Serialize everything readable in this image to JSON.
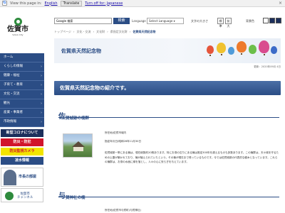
{
  "translate_bar": {
    "view_label": "View this page in:",
    "language_link": "English",
    "translate_button": "Translate",
    "turn_off_label": "Turn off for: Japanese",
    "close_glyph": "×"
  },
  "header": {
    "logo_name": "佐賀市",
    "logo_sub": "SAGA City",
    "search_value": "Google 検索",
    "search_button": "検索",
    "language_label": "Language",
    "language_select": "Select Language ▾",
    "font_size_label": "文字の大きさ",
    "font_size_buttons": [
      "標準",
      "拡大"
    ],
    "color_label": "背景色",
    "background_colors": [
      "#ffffff",
      "#1c2f5c",
      "#1c2f5c"
    ]
  },
  "breadcrumb": [
    "トップページ",
    "›",
    "文化・交流",
    "›",
    "文化財",
    "›",
    "県指定文化財",
    "›"
  ],
  "breadcrumb_current": "佐賀県天然記念物",
  "sidebar": {
    "items": [
      "ホーム",
      "くらしの情報",
      "健康・福祉",
      "子育て・教育",
      "文化・交流",
      "観光",
      "産業・事業者",
      "市政情報"
    ],
    "banners": [
      "新型コロナについて",
      "防災・防犯",
      "防災監視カメラ",
      "凌水情報"
    ],
    "mayor_label": "市長の部屋",
    "channel_label_1": "佐賀市",
    "channel_label_2": "チャンネル"
  },
  "hero": {
    "title": "佐賀県天然記念物"
  },
  "update_text": "更新：2020年09月 4日",
  "intro_heading": "佐賀県天然記念物の紹介です。",
  "sections": [
    {
      "initial": "佐",
      "title_rest": "賀城跡の楠群",
      "location": "所在地(佐賀市城内",
      "designated": "指定年月日(昭和28年11月30日",
      "description": "佐賀城跡一帯にある楠は、現在総数約20株あります。特にお濠の辺りにある楠は推定300年を超えるものも多数あります。この楠群は、天々城を守るための土塁が築かれており、楠が植えられていたという。その楠が現在まで残っているものです。今では佐賀城跡の代表的な樹木となっています。これらの楠群は、お濠の水面に緑を落とし、人々の心に安らぎを与えています。"
    },
    {
      "initial": "与",
      "title_rest": "賀神社の楠",
      "location": "所在地(佐賀市与賀町(与賀神社)"
    }
  ]
}
